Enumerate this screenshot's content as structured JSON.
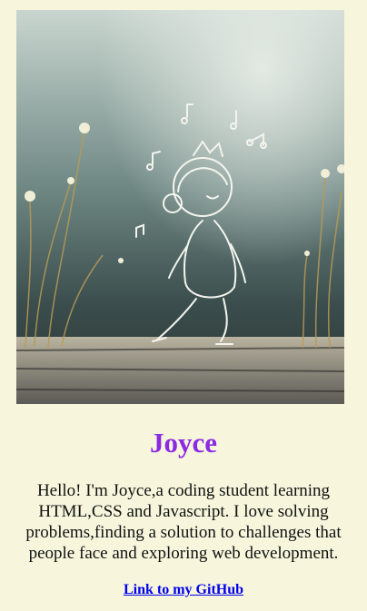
{
  "profile": {
    "image_icon": "sketch-boy-with-headphones-icon",
    "name": "Joyce",
    "bio": "Hello! I'm Joyce,a coding student learning HTML,CSS and Javascript. I love solving problems,finding a solution to challenges that people face and exploring web development.",
    "github_link_text": "Link to my GitHub"
  },
  "colors": {
    "background": "#f7f6dd",
    "name": "#8a2be2",
    "link": "#0000ee"
  }
}
